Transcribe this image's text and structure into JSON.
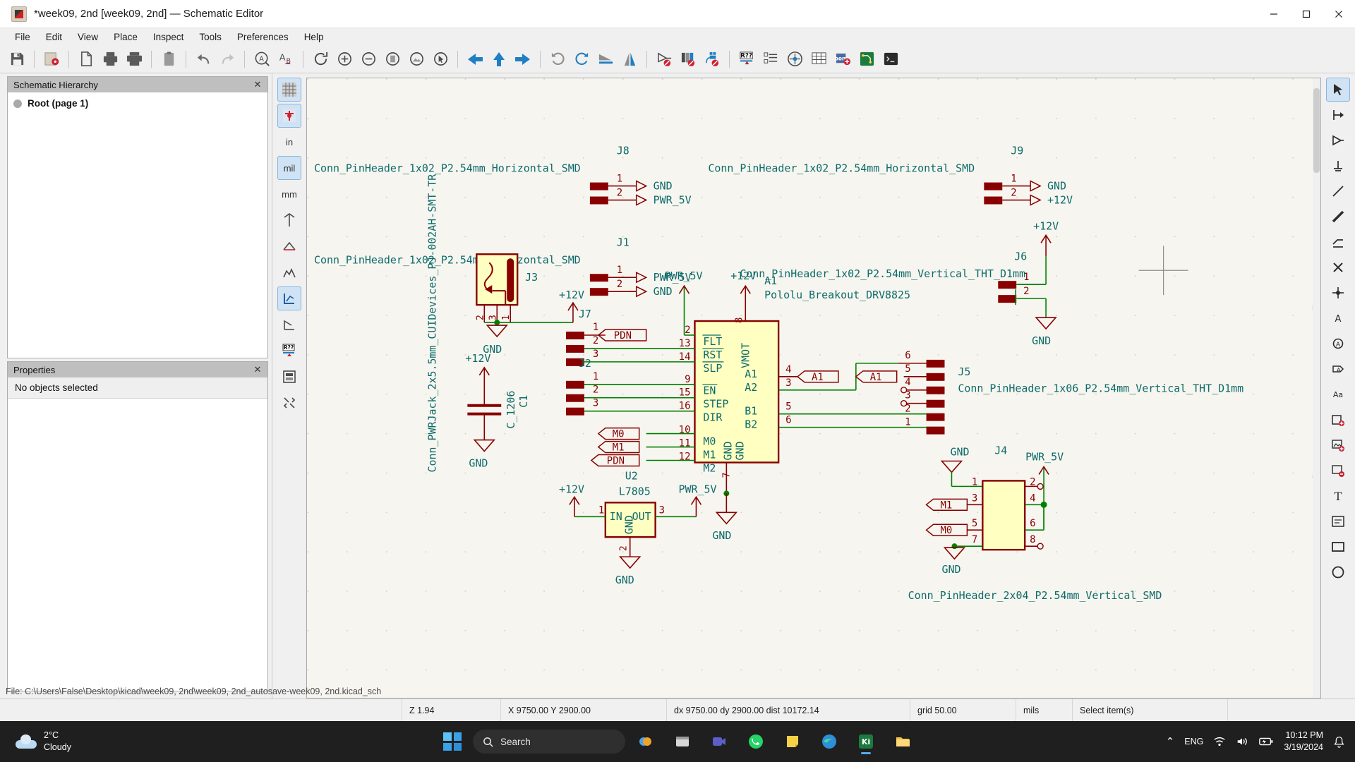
{
  "window": {
    "title": "*week09, 2nd [week09, 2nd] — Schematic Editor",
    "minimize": "─",
    "maximize": "☐",
    "close": "✕"
  },
  "menu": [
    "File",
    "Edit",
    "View",
    "Place",
    "Inspect",
    "Tools",
    "Preferences",
    "Help"
  ],
  "toolbar": [
    {
      "name": "save-icon",
      "tip": "Save"
    },
    {
      "name": "page-settings-icon",
      "tip": "Page settings"
    },
    {
      "name": "new-sheet-icon",
      "tip": "New sheet"
    },
    {
      "name": "print-icon",
      "tip": "Print"
    },
    {
      "name": "plot-icon",
      "tip": "Plot"
    },
    {
      "name": "paste-icon",
      "tip": "Paste"
    },
    {
      "name": "undo-icon",
      "tip": "Undo"
    },
    {
      "name": "redo-icon",
      "tip": "Redo"
    },
    {
      "name": "find-icon",
      "tip": "Find"
    },
    {
      "name": "find-replace-icon",
      "tip": "Find and replace"
    },
    {
      "name": "refresh-icon",
      "tip": "Refresh"
    },
    {
      "name": "zoom-in-icon",
      "tip": "Zoom in"
    },
    {
      "name": "zoom-out-icon",
      "tip": "Zoom out"
    },
    {
      "name": "zoom-fit-page-icon",
      "tip": "Zoom to fit page"
    },
    {
      "name": "zoom-fit-objects-icon",
      "tip": "Zoom to fit objects"
    },
    {
      "name": "zoom-area-icon",
      "tip": "Zoom to selection"
    },
    {
      "name": "leave-sheet-icon",
      "tip": "Leave sheet"
    },
    {
      "name": "up-sheet-icon",
      "tip": "Go up"
    },
    {
      "name": "enter-sheet-icon",
      "tip": "Enter sheet"
    },
    {
      "name": "rotate-ccw-icon",
      "tip": "Rotate counterclockwise"
    },
    {
      "name": "rotate-cw-icon",
      "tip": "Rotate clockwise"
    },
    {
      "name": "mirror-horizontal-icon",
      "tip": "Mirror horizontally"
    },
    {
      "name": "mirror-vertical-icon",
      "tip": "Mirror vertically"
    },
    {
      "name": "symbol-editor-icon",
      "tip": "Symbol editor"
    },
    {
      "name": "symbol-library-icon",
      "tip": "Symbol library browser"
    },
    {
      "name": "simulator-icon",
      "tip": "Simulator"
    },
    {
      "name": "annotate-icon",
      "tip": "Annotate schematic"
    },
    {
      "name": "erc-icon",
      "tip": "Electrical rules checker"
    },
    {
      "name": "footprint-assign-icon",
      "tip": "Assign footprints"
    },
    {
      "name": "bom-icon",
      "tip": "Generate bill of materials"
    },
    {
      "name": "netlist-icon",
      "tip": "Export netlist"
    },
    {
      "name": "pcb-editor-icon",
      "tip": "Open PCB editor"
    },
    {
      "name": "scripting-console-icon",
      "tip": "Scripting console"
    }
  ],
  "panels": {
    "hierarchy": {
      "title": "Schematic Hierarchy",
      "close": "✕",
      "root_label": "Root (page 1)"
    },
    "properties": {
      "title": "Properties",
      "close": "✕",
      "empty_text": "No objects selected"
    }
  },
  "left_vtoolbar": [
    {
      "name": "grid-toggle-icon",
      "label": ""
    },
    {
      "name": "show-hidden-pins-icon",
      "label": ""
    },
    {
      "name": "units-inches-button",
      "label": "in"
    },
    {
      "name": "units-mils-button",
      "label": "mil"
    },
    {
      "name": "units-millimeters-button",
      "label": "mm"
    },
    {
      "name": "cursor-full-window-icon",
      "label": ""
    },
    {
      "name": "hv-wire-mode-icon",
      "label": ""
    },
    {
      "name": "net-highlight-icon",
      "label": ""
    },
    {
      "name": "erc-markers-icon",
      "label": ""
    },
    {
      "name": "pin-numbers-icon",
      "label": ""
    },
    {
      "name": "annotate-auto-icon",
      "label": ""
    },
    {
      "name": "hierarchy-navigator-icon",
      "label": ""
    },
    {
      "name": "tools-misc-icon",
      "label": ""
    }
  ],
  "right_vtoolbar": [
    {
      "name": "select-tool-icon",
      "active": true
    },
    {
      "name": "highlight-net-tool-icon",
      "active": false
    },
    {
      "name": "place-symbol-tool-icon",
      "active": false
    },
    {
      "name": "place-power-tool-icon",
      "active": false
    },
    {
      "name": "draw-wire-tool-icon",
      "active": false
    },
    {
      "name": "draw-bus-tool-icon",
      "active": false
    },
    {
      "name": "wire-to-bus-entry-tool-icon",
      "active": false
    },
    {
      "name": "no-connect-tool-icon",
      "active": false
    },
    {
      "name": "junction-tool-icon",
      "active": false
    },
    {
      "name": "net-label-tool-icon",
      "active": false
    },
    {
      "name": "global-label-tool-icon",
      "active": false
    },
    {
      "name": "hierarchical-label-tool-icon",
      "active": false
    },
    {
      "name": "sheet-pin-tool-icon",
      "active": false
    },
    {
      "name": "text-note-tool-icon",
      "active": false
    },
    {
      "name": "import-sheet-pin-tool-icon",
      "active": false
    },
    {
      "name": "add-image-tool-icon",
      "active": false
    },
    {
      "name": "delete-tool-icon",
      "active": false
    },
    {
      "name": "text-tool-icon",
      "active": false
    },
    {
      "name": "textbox-tool-icon",
      "active": false
    },
    {
      "name": "rectangle-tool-icon",
      "active": false
    },
    {
      "name": "circle-tool-icon",
      "active": false
    }
  ],
  "status": {
    "zoom": "Z 1.94",
    "coords": "X 9750.00  Y 2900.00",
    "delta": "dx 9750.00  dy 2900.00  dist 10172.14",
    "grid": "grid 50.00",
    "units": "mils",
    "tool": "Select item(s)",
    "filepath": "File: C:\\Users\\False\\Desktop\\kicad\\week09, 2nd\\week09, 2nd_autosave-week09, 2nd.kicad_sch"
  },
  "taskbar": {
    "weather_temp": "2°C",
    "weather_desc": "Cloudy",
    "search_placeholder": "Search",
    "search_icon": "search-icon",
    "items": [
      {
        "name": "taskbar-widgets",
        "label": "widgets-icon"
      },
      {
        "name": "taskbar-chrome",
        "label": "chrome-icon"
      },
      {
        "name": "taskbar-folder-explorer",
        "label": "file-explorer-icon"
      },
      {
        "name": "taskbar-teams",
        "label": "teams-icon"
      },
      {
        "name": "taskbar-whatsapp",
        "label": "whatsapp-icon"
      },
      {
        "name": "taskbar-notes",
        "label": "sticky-notes-icon"
      },
      {
        "name": "taskbar-edge",
        "label": "edge-icon"
      },
      {
        "name": "taskbar-kicad",
        "label": "kicad-icon"
      },
      {
        "name": "taskbar-explorer-2",
        "label": "folder-icon"
      }
    ],
    "tray": {
      "chevron": "⌃",
      "language": "ENG",
      "wifi": "wifi-icon",
      "volume": "volume-icon",
      "battery": "battery-charging-icon",
      "time": "10:12 PM",
      "date": "3/19/2024",
      "notifications": "bell-icon"
    }
  },
  "schematic": {
    "components": [
      {
        "ref": "J8",
        "value": "Conn_PinHeader_1x02_P2.54mm_Horizontal_SMD",
        "pins": [
          "1",
          "2"
        ],
        "nets": [
          "GND",
          "PWR_5V"
        ]
      },
      {
        "ref": "J9",
        "value": "Conn_PinHeader_1x02_P2.54mm_Horizontal_SMD",
        "pins": [
          "1",
          "2"
        ],
        "nets": [
          "GND",
          "+12V"
        ]
      },
      {
        "ref": "J1",
        "value": "Conn_PinHeader_1x02_P2.54mm_Horizontal_SMD",
        "pins": [
          "1",
          "2"
        ],
        "nets": [
          "PWR_5V",
          "GND"
        ]
      },
      {
        "ref": "J6",
        "value": "Conn_PinHeader_1x02_P2.54mm_Vertical_THT_D1mm",
        "pins": [
          "1",
          "2"
        ],
        "nets": [
          "+12V",
          "GND"
        ]
      },
      {
        "ref": "J3",
        "value": "Conn_PWRJack_2x5.5mm_CUIDevices_PJ-002AH-SMT-TR",
        "pins": [
          "1",
          "2",
          "3"
        ],
        "nets": [
          "+12V",
          "GND"
        ]
      },
      {
        "ref": "C1",
        "value": "C_1206",
        "nets": [
          "+12V",
          "GND"
        ]
      },
      {
        "ref": "J7",
        "value": "",
        "pins": [
          "1",
          "2",
          "3"
        ]
      },
      {
        "ref": "J2",
        "value": "",
        "pins": [
          "1",
          "2",
          "3"
        ]
      },
      {
        "ref": "A1",
        "value": "Pololu_Breakout_DRV8825",
        "pins": [
          "2",
          "13",
          "14",
          "9",
          "15",
          "16",
          "10",
          "11",
          "12",
          "8",
          "4",
          "3",
          "5",
          "6",
          "7"
        ]
      },
      {
        "ref": "J5",
        "value": "Conn_PinHeader_1x06_P2.54mm_Vertical_THT_D1mm",
        "pins": [
          "1",
          "2",
          "3",
          "4",
          "5",
          "6"
        ]
      },
      {
        "ref": "U2",
        "value": "L7805",
        "pins": [
          "1",
          "2",
          "3"
        ],
        "nets": [
          "+12V",
          "GND",
          "PWR_5V"
        ]
      },
      {
        "ref": "J4",
        "value": "Conn_PinHeader_2x04_P2.54mm_Vertical_SMD",
        "pins": [
          "1",
          "2",
          "3",
          "4",
          "5",
          "6",
          "7",
          "8"
        ]
      }
    ],
    "labels": {
      "j8_ref": "J8",
      "j8_value": "Conn_PinHeader_1x02_P2.54mm_Horizontal_SMD",
      "j9_ref": "J9",
      "j9_value": "Conn_PinHeader_1x02_P2.54mm_Horizontal_SMD",
      "j1_ref": "J1",
      "j1_value": "Conn_PinHeader_1x02_P2.54mm_Horizontal_SMD",
      "j6_ref": "J6",
      "j6_value": "Conn_PinHeader_1x02_P2.54mm_Vertical_THT_D1mm",
      "j3_ref": "J3",
      "j3_value": "Conn_PWRJack_2x5.5mm_CUIDevices_PJ-002AH-SMT-TR",
      "c1_ref": "C1",
      "c1_value": "C_1206",
      "j7_ref": "J7",
      "j2_ref": "J2",
      "a1_ref": "A1",
      "a1_value": "Pololu_Breakout_DRV8825",
      "j5_ref": "J5",
      "j5_value": "Conn_PinHeader_1x06_P2.54mm_Vertical_THT_D1mm",
      "u2_ref": "U2",
      "u2_value": "L7805",
      "j4_ref": "J4",
      "j4_value": "Conn_PinHeader_2x04_P2.54mm_Vertical_SMD",
      "net_gnd": "GND",
      "net_pwr5v": "PWR_5V",
      "net_12v": "+12V",
      "label_pdn": "PDN",
      "label_m0": "M0",
      "label_m1": "M1",
      "label_a1": "A1",
      "pin_flt": "FLT",
      "pin_rst": "RST",
      "pin_slp": "SLP",
      "pin_en": "EN",
      "pin_step": "STEP",
      "pin_dir": "DIR",
      "pin_m0": "M0",
      "pin_m1": "M1",
      "pin_m2": "M2",
      "pin_vmot": "VMOT",
      "pin_gnd": "GND",
      "pin_a1": "A1",
      "pin_a2": "A2",
      "pin_b1": "B1",
      "pin_b2": "B2",
      "pin_in": "IN",
      "pin_out": "OUT"
    }
  }
}
